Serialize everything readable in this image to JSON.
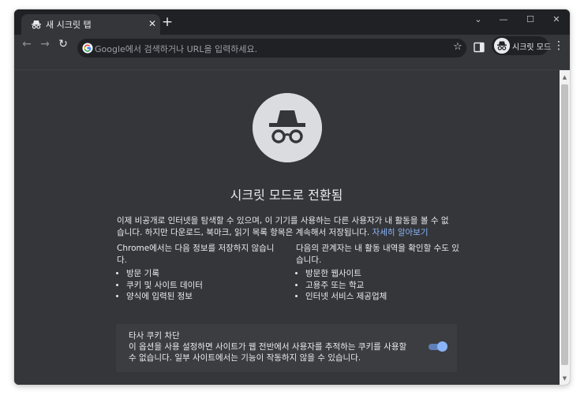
{
  "tab": {
    "title": "새 시크릿 탭",
    "close_glyph": "✕"
  },
  "new_tab_glyph": "+",
  "window_controls": {
    "dropdown": "⌄",
    "minimize": "—",
    "maximize": "☐",
    "close": "✕"
  },
  "toolbar": {
    "back_glyph": "←",
    "forward_glyph": "→",
    "reload_glyph": "↻",
    "star_glyph": "☆",
    "menu_glyph": "⋮"
  },
  "omnibox": {
    "placeholder": "Google에서 검색하거나 URL을 입력하세요."
  },
  "profile": {
    "label": "시크릿 모드"
  },
  "content": {
    "heading": "시크릿 모드로 전환됨",
    "intro": "이제 비공개로 인터넷을 탐색할 수 있으며, 이 기기를 사용하는 다른 사용자가 내 활동을 볼 수 없습니다. 하지만 다운로드, 북마크, 읽기 목록 항목은 계속해서 저장됩니다.",
    "learn_more": "자세히 알아보기",
    "left_column": {
      "title": "Chrome에서는 다음 정보를 저장하지 않습니다.",
      "items": [
        "방문 기록",
        "쿠키 및 사이트 데이터",
        "양식에 입력된 정보"
      ]
    },
    "right_column": {
      "title": "다음의 관계자는 내 활동 내역을 확인할 수도 있습니다.",
      "items": [
        "방문한 웹사이트",
        "고용주 또는 학교",
        "인터넷 서비스 제공업체"
      ]
    },
    "cookie_card": {
      "title": "타사 쿠키 차단",
      "description": "이 옵션을 사용 설정하면 사이트가 웹 전반에서 사용자를 추적하는 쿠키를 사용할 수 없습니다. 일부 사이트에서는 기능이 작동하지 않을 수 있습니다.",
      "toggle_on": true
    }
  },
  "icons": {
    "tab_icon": "incognito-icon",
    "omnibox_icon": "google-g-icon",
    "hero_icon": "incognito-icon",
    "sidepanel_icon": "side-panel-icon",
    "profile_icon": "incognito-icon"
  },
  "colors": {
    "frame": "#202124",
    "toolbar": "#35363a",
    "content_bg": "#35363a",
    "card_bg": "#3c3d41",
    "text": "#e8eaed",
    "link": "#8ab4f8",
    "hero_circle": "#dadce0"
  }
}
